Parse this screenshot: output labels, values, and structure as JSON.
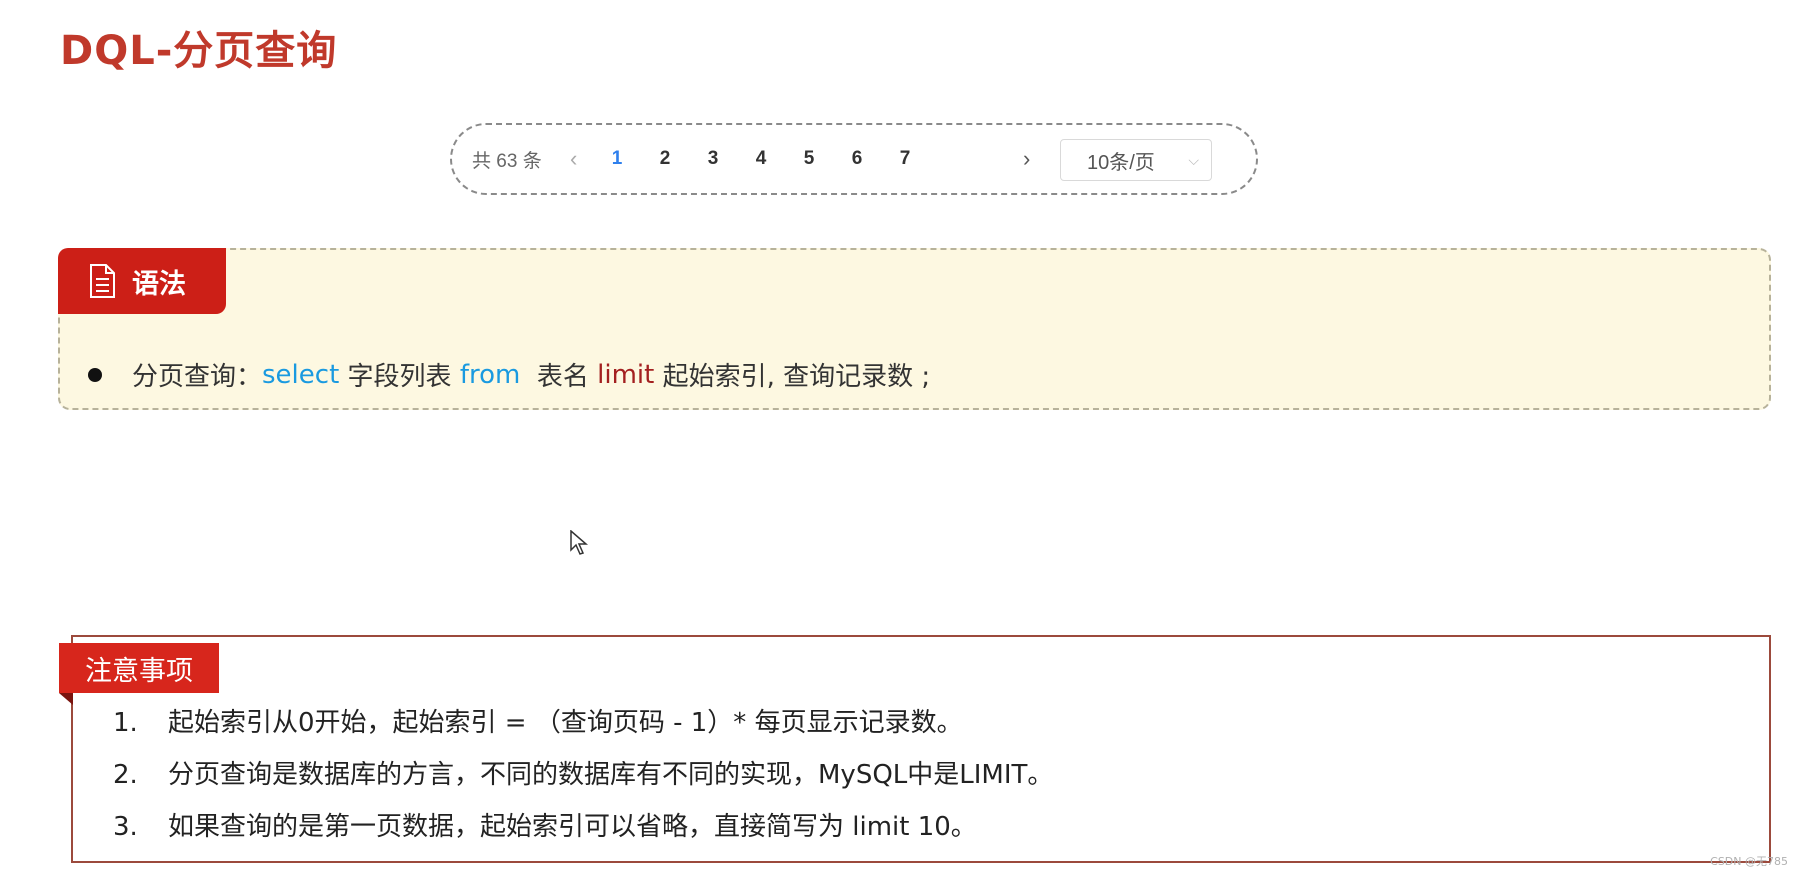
{
  "title": "DQL-分页查询",
  "pagination": {
    "total": "共 63 条",
    "prev": "‹",
    "pages": [
      "1",
      "2",
      "3",
      "4",
      "5",
      "6",
      "7"
    ],
    "active_page": "1",
    "next": "›",
    "page_size": "10条/页",
    "page_size_chevron": "⌵"
  },
  "syntax": {
    "tag_label": "语法",
    "icon": "document-icon",
    "parts": {
      "lead": "分页查询：",
      "select": "select",
      "fields": " 字段列表 ",
      "from": "from",
      "table": "  表名 ",
      "limit": "limit",
      "rest": " 起始索引, 查询记录数 ;"
    }
  },
  "notes": {
    "tag_label": "注意事项",
    "items": [
      {
        "num": "1.",
        "text": "起始索引从0开始，起始索引 = （查询页码 - 1）* 每页显示记录数。"
      },
      {
        "num": "2.",
        "text": "分页查询是数据库的方言，不同的数据库有不同的实现，MySQL中是LIMIT。"
      },
      {
        "num": "3.",
        "text": "如果查询的是第一页数据，起始索引可以省略，直接简写为 limit 10。"
      }
    ]
  },
  "watermark": "CSDN @无785",
  "colors": {
    "title": "#c0392b",
    "tag_red": "#cc1f17",
    "keyword_blue": "#1a9ae0",
    "keyword_red": "#a32020",
    "syntax_bg": "#fdf8e1",
    "active_page": "#2f80ed"
  }
}
